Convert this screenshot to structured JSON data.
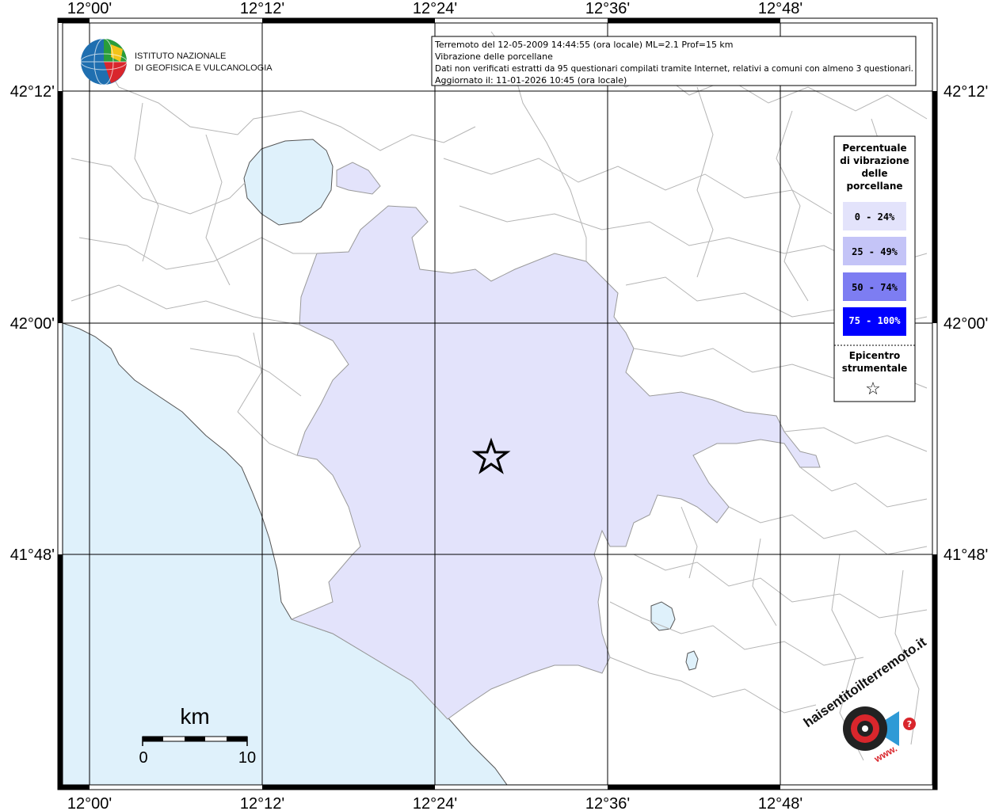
{
  "map": {
    "ticks_top": [
      "12°00'",
      "12°12'",
      "12°24'",
      "12°36'",
      "12°48'"
    ],
    "ticks_bottom": [
      "12°00'",
      "12°12'",
      "12°24'",
      "12°36'",
      "12°48'"
    ],
    "ticks_left": [
      "42°12'",
      "42°00'",
      "41°48'"
    ],
    "ticks_right": [
      "42°12'",
      "42°00'",
      "41°48'"
    ],
    "colors": {
      "sea": "#dff1fb",
      "land": "#ffffff",
      "class_0_24": "#e3e3fb",
      "class_25_49": "#c4c4f7",
      "class_50_74": "#7d7df2",
      "class_75_100": "#0000ff",
      "borders": "#9a9a9a"
    }
  },
  "logo": {
    "line1": "ISTITUTO NAZIONALE",
    "line2": "DI GEOFISICA E VULCANOLOGIA"
  },
  "info_box": {
    "line1": "Terremoto del 12-05-2009 14:44:55 (ora locale) ML=2.1 Prof=15 km",
    "line2": "Vibrazione delle porcellane",
    "line3": "Dati non verificati estratti da 95 questionari compilati tramite Internet, relativi a comuni con almeno 3 questionari.",
    "line4": "Aggiornato il: 11-01-2026 10:45 (ora locale)"
  },
  "legend": {
    "title": [
      "Percentuale",
      "di vibrazione",
      "delle",
      "porcellane"
    ],
    "classes": [
      "0 - 24%",
      "25 - 49%",
      "50 - 74%",
      "75 - 100%"
    ],
    "epicenter_title": [
      "Epicentro",
      "strumentale"
    ],
    "star_glyph": "☆"
  },
  "scale_bar": {
    "unit": "km",
    "min_label": "0",
    "max_label": "10"
  },
  "watermark": {
    "text": "haisentitoilterremoto.it",
    "www": "www.",
    "q": "?"
  }
}
